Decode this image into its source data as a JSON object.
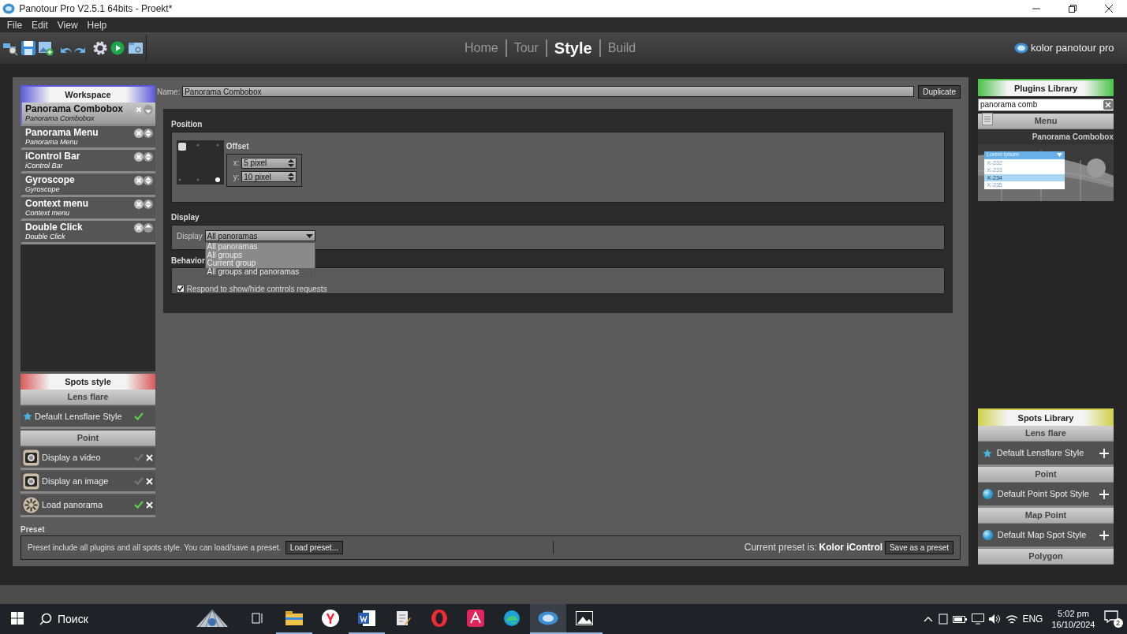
{
  "window": {
    "title": "Panotour Pro V2.5.1 64bits - Proekt*"
  },
  "menu": [
    "File",
    "Edit",
    "View",
    "Help"
  ],
  "mode_tabs": [
    {
      "label": "Home",
      "selected": false
    },
    {
      "label": "Tour",
      "selected": false
    },
    {
      "label": "Style",
      "selected": true
    },
    {
      "label": "Build",
      "selected": false
    }
  ],
  "logo_text": "kolor panotour pro",
  "workspace": {
    "title": "Workspace",
    "items": [
      {
        "name": "Panorama Combobox",
        "subtitle": "Panorama Combobox",
        "selected": true,
        "kind": "first"
      },
      {
        "name": "Panorama Menu",
        "subtitle": "Panorama Menu",
        "selected": false,
        "kind": "middle"
      },
      {
        "name": "iControl Bar",
        "subtitle": "iControl Bar",
        "selected": false,
        "kind": "middle"
      },
      {
        "name": "Gyroscope",
        "subtitle": "Gyroscope",
        "selected": false,
        "kind": "middle"
      },
      {
        "name": "Context menu",
        "subtitle": "Context menu",
        "selected": false,
        "kind": "middle"
      },
      {
        "name": "Double Click",
        "subtitle": "Double Click",
        "selected": false,
        "kind": "last"
      }
    ]
  },
  "spots_style": {
    "title": "Spots style",
    "groups": [
      {
        "title": "Lens flare",
        "items": [
          {
            "label": "Default Lensflare Style",
            "kind": "star",
            "active": true,
            "removable": false
          }
        ]
      },
      {
        "title": "Point",
        "items": [
          {
            "label": "Display a video",
            "kind": "camera",
            "active": false,
            "removable": true
          },
          {
            "label": "Display an image",
            "kind": "camera",
            "active": false,
            "removable": true
          },
          {
            "label": "Load panorama",
            "kind": "loader",
            "active": true,
            "removable": true
          }
        ]
      }
    ]
  },
  "editor": {
    "name_label": "Name:",
    "name_value": "Panorama Combobox",
    "duplicate": "Duplicate",
    "position": {
      "title": "Position",
      "offset_title": "Offset",
      "x_label": "x:",
      "x_value": "5 pixel",
      "y_label": "y:",
      "y_value": "10 pixel"
    },
    "display": {
      "title": "Display",
      "label": "Display",
      "value": "All panoramas",
      "options": [
        {
          "label": "All panoramas",
          "highlighted": false
        },
        {
          "label": "All groups",
          "highlighted": false
        },
        {
          "label": "Current group",
          "highlighted": false
        },
        {
          "label": "All groups and panoramas",
          "highlighted": true
        }
      ]
    },
    "behavior": {
      "title": "Behavior",
      "items": [
        {
          "label": "Respond to show/hide controls requests",
          "checked": true
        }
      ]
    }
  },
  "preset": {
    "title": "Preset",
    "text": "Preset include all plugins and all spots style. You can load/save a preset.",
    "load_button": "Load preset...",
    "current_label": "Current preset is:",
    "current_value": "Kolor iControl",
    "save_button": "Save as a preset"
  },
  "plugins_library": {
    "title": "Plugins Library",
    "search": "panorama comb",
    "category": "Menu",
    "plugin_name": "Panorama Combobox",
    "preview": {
      "header": "Lorem Ipsum",
      "rows": [
        {
          "label": "K-232",
          "selected": false
        },
        {
          "label": "K-233",
          "selected": false
        },
        {
          "label": "K-234",
          "selected": true
        },
        {
          "label": "K-235",
          "selected": false
        }
      ]
    }
  },
  "spots_library": {
    "title": "Spots Library",
    "groups": [
      {
        "title": "Lens flare",
        "items": [
          {
            "label": "Default Lensflare Style",
            "kind": "star"
          }
        ]
      },
      {
        "title": "Point",
        "items": [
          {
            "label": "Default Point Spot Style",
            "kind": "sphere"
          }
        ]
      },
      {
        "title": "Map Point",
        "items": [
          {
            "label": "Default Map Spot Style",
            "kind": "sphere"
          }
        ]
      },
      {
        "title": "Polygon"
      }
    ]
  },
  "taskbar": {
    "search_placeholder": "Поиск",
    "apps": [
      {
        "kind": "shell",
        "running": false,
        "selected": false
      },
      {
        "kind": "taskview",
        "running": false,
        "selected": false
      },
      {
        "kind": "explorer",
        "running": true,
        "selected": false
      },
      {
        "kind": "yandex",
        "running": false,
        "selected": false
      },
      {
        "kind": "word",
        "running": true,
        "selected": false
      },
      {
        "kind": "notes",
        "running": false,
        "selected": false
      },
      {
        "kind": "opera",
        "running": false,
        "selected": false
      },
      {
        "kind": "acrobat",
        "running": false,
        "selected": false
      },
      {
        "kind": "edge",
        "running": false,
        "selected": false
      },
      {
        "kind": "ptp",
        "running": true,
        "selected": true
      },
      {
        "kind": "photos",
        "running": true,
        "selected": false
      }
    ],
    "language": "ENG",
    "time": "5:02 pm",
    "date": "16/10/2024",
    "notifications": "2"
  }
}
